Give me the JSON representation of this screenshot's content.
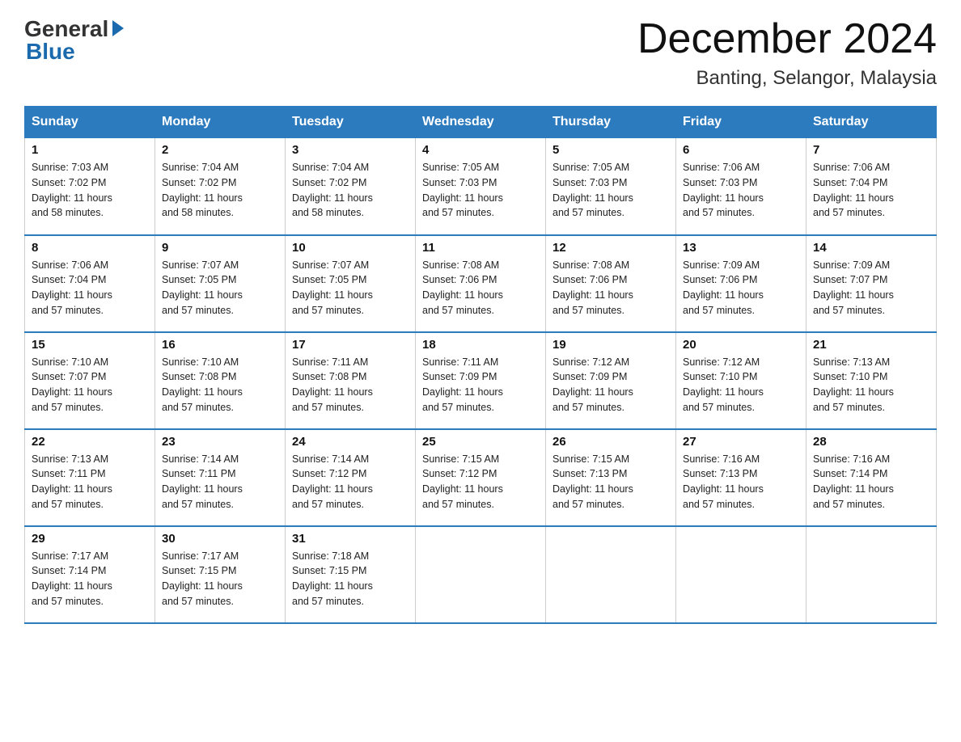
{
  "logo": {
    "general": "General",
    "blue": "Blue"
  },
  "title": {
    "month": "December 2024",
    "location": "Banting, Selangor, Malaysia"
  },
  "headers": [
    "Sunday",
    "Monday",
    "Tuesday",
    "Wednesday",
    "Thursday",
    "Friday",
    "Saturday"
  ],
  "weeks": [
    [
      {
        "day": "1",
        "sunrise": "7:03 AM",
        "sunset": "7:02 PM",
        "daylight": "11 hours and 58 minutes."
      },
      {
        "day": "2",
        "sunrise": "7:04 AM",
        "sunset": "7:02 PM",
        "daylight": "11 hours and 58 minutes."
      },
      {
        "day": "3",
        "sunrise": "7:04 AM",
        "sunset": "7:02 PM",
        "daylight": "11 hours and 58 minutes."
      },
      {
        "day": "4",
        "sunrise": "7:05 AM",
        "sunset": "7:03 PM",
        "daylight": "11 hours and 57 minutes."
      },
      {
        "day": "5",
        "sunrise": "7:05 AM",
        "sunset": "7:03 PM",
        "daylight": "11 hours and 57 minutes."
      },
      {
        "day": "6",
        "sunrise": "7:06 AM",
        "sunset": "7:03 PM",
        "daylight": "11 hours and 57 minutes."
      },
      {
        "day": "7",
        "sunrise": "7:06 AM",
        "sunset": "7:04 PM",
        "daylight": "11 hours and 57 minutes."
      }
    ],
    [
      {
        "day": "8",
        "sunrise": "7:06 AM",
        "sunset": "7:04 PM",
        "daylight": "11 hours and 57 minutes."
      },
      {
        "day": "9",
        "sunrise": "7:07 AM",
        "sunset": "7:05 PM",
        "daylight": "11 hours and 57 minutes."
      },
      {
        "day": "10",
        "sunrise": "7:07 AM",
        "sunset": "7:05 PM",
        "daylight": "11 hours and 57 minutes."
      },
      {
        "day": "11",
        "sunrise": "7:08 AM",
        "sunset": "7:06 PM",
        "daylight": "11 hours and 57 minutes."
      },
      {
        "day": "12",
        "sunrise": "7:08 AM",
        "sunset": "7:06 PM",
        "daylight": "11 hours and 57 minutes."
      },
      {
        "day": "13",
        "sunrise": "7:09 AM",
        "sunset": "7:06 PM",
        "daylight": "11 hours and 57 minutes."
      },
      {
        "day": "14",
        "sunrise": "7:09 AM",
        "sunset": "7:07 PM",
        "daylight": "11 hours and 57 minutes."
      }
    ],
    [
      {
        "day": "15",
        "sunrise": "7:10 AM",
        "sunset": "7:07 PM",
        "daylight": "11 hours and 57 minutes."
      },
      {
        "day": "16",
        "sunrise": "7:10 AM",
        "sunset": "7:08 PM",
        "daylight": "11 hours and 57 minutes."
      },
      {
        "day": "17",
        "sunrise": "7:11 AM",
        "sunset": "7:08 PM",
        "daylight": "11 hours and 57 minutes."
      },
      {
        "day": "18",
        "sunrise": "7:11 AM",
        "sunset": "7:09 PM",
        "daylight": "11 hours and 57 minutes."
      },
      {
        "day": "19",
        "sunrise": "7:12 AM",
        "sunset": "7:09 PM",
        "daylight": "11 hours and 57 minutes."
      },
      {
        "day": "20",
        "sunrise": "7:12 AM",
        "sunset": "7:10 PM",
        "daylight": "11 hours and 57 minutes."
      },
      {
        "day": "21",
        "sunrise": "7:13 AM",
        "sunset": "7:10 PM",
        "daylight": "11 hours and 57 minutes."
      }
    ],
    [
      {
        "day": "22",
        "sunrise": "7:13 AM",
        "sunset": "7:11 PM",
        "daylight": "11 hours and 57 minutes."
      },
      {
        "day": "23",
        "sunrise": "7:14 AM",
        "sunset": "7:11 PM",
        "daylight": "11 hours and 57 minutes."
      },
      {
        "day": "24",
        "sunrise": "7:14 AM",
        "sunset": "7:12 PM",
        "daylight": "11 hours and 57 minutes."
      },
      {
        "day": "25",
        "sunrise": "7:15 AM",
        "sunset": "7:12 PM",
        "daylight": "11 hours and 57 minutes."
      },
      {
        "day": "26",
        "sunrise": "7:15 AM",
        "sunset": "7:13 PM",
        "daylight": "11 hours and 57 minutes."
      },
      {
        "day": "27",
        "sunrise": "7:16 AM",
        "sunset": "7:13 PM",
        "daylight": "11 hours and 57 minutes."
      },
      {
        "day": "28",
        "sunrise": "7:16 AM",
        "sunset": "7:14 PM",
        "daylight": "11 hours and 57 minutes."
      }
    ],
    [
      {
        "day": "29",
        "sunrise": "7:17 AM",
        "sunset": "7:14 PM",
        "daylight": "11 hours and 57 minutes."
      },
      {
        "day": "30",
        "sunrise": "7:17 AM",
        "sunset": "7:15 PM",
        "daylight": "11 hours and 57 minutes."
      },
      {
        "day": "31",
        "sunrise": "7:18 AM",
        "sunset": "7:15 PM",
        "daylight": "11 hours and 57 minutes."
      },
      null,
      null,
      null,
      null
    ]
  ],
  "labels": {
    "sunrise": "Sunrise:",
    "sunset": "Sunset:",
    "daylight": "Daylight:"
  }
}
